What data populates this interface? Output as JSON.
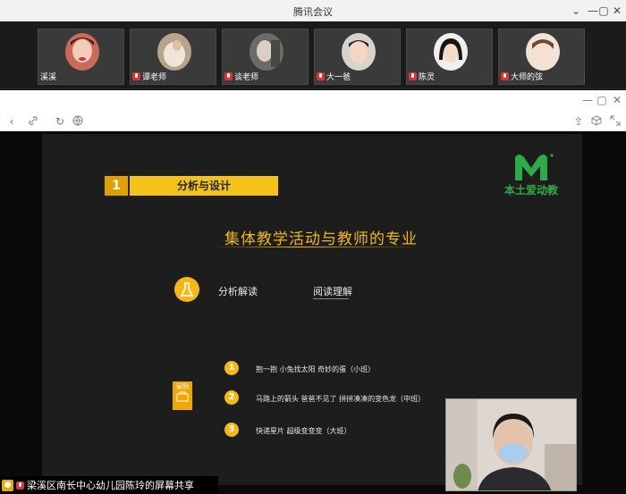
{
  "app": {
    "title": "腾讯会议",
    "window_buttons": [
      "⌄",
      "—",
      "▢",
      "✕"
    ]
  },
  "participants": [
    {
      "name": "溪溪",
      "muted": false
    },
    {
      "name": "谭老师",
      "muted": true
    },
    {
      "name": "谈老师",
      "muted": true
    },
    {
      "name": "大一爸",
      "muted": true
    },
    {
      "name": "陈灵",
      "muted": true
    },
    {
      "name": "大师的弦",
      "muted": true
    }
  ],
  "slide": {
    "section_number": "1",
    "section_title": "分析与设计",
    "logo_text": "本土爱动教",
    "main_title": "集体教学活动与教师的专业",
    "point_label": "分析解读",
    "point_value": "阅读理解",
    "case_label": "案例",
    "cases": [
      {
        "num": "1",
        "text": "抱一抱   小兔找太阳   奇妙的蛋（小班）"
      },
      {
        "num": "2",
        "text": "马路上的箭头   爸爸不见了  拼拼凑凑的变色龙（中班）"
      },
      {
        "num": "3",
        "text": "快递星片   超级变变变（大班）"
      }
    ]
  },
  "share_status": "梁溪区南长中心幼儿园陈玲的屏幕共享",
  "colors": {
    "accent_yellow": "#f5c318",
    "logo_green": "#2faa4a"
  }
}
